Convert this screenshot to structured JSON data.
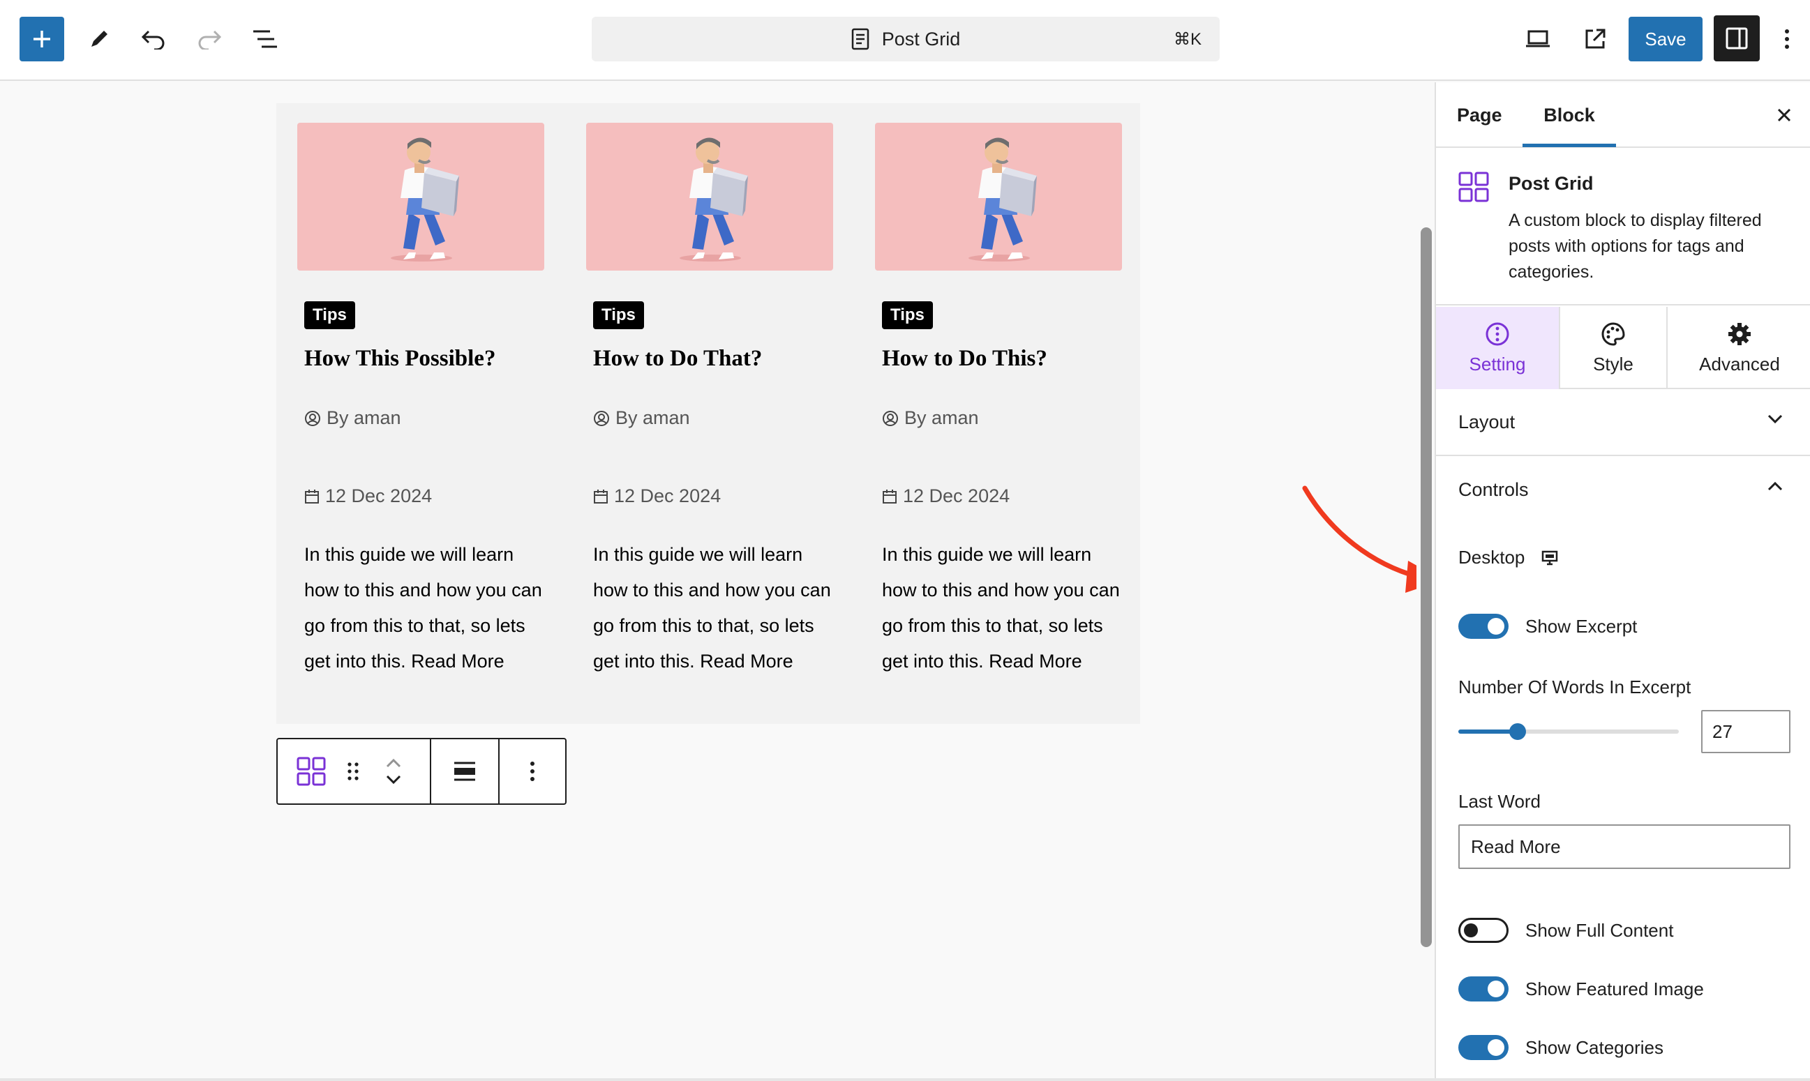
{
  "topbar": {
    "command_title": "Post Grid",
    "command_shortcut": "⌘K",
    "save_label": "Save"
  },
  "posts": [
    {
      "category": "Tips",
      "title": "How This Possible?",
      "author": "By aman",
      "date": "12 Dec 2024",
      "excerpt": "In this guide we will learn how to this and how you can go from this to that, so lets get into this. Read More"
    },
    {
      "category": "Tips",
      "title": "How to Do That?",
      "author": "By aman",
      "date": "12 Dec 2024",
      "excerpt": "In this guide we will learn how to this and how you can go from this to that, so lets get into this. Read More"
    },
    {
      "category": "Tips",
      "title": "How to Do This?",
      "author": "By aman",
      "date": "12 Dec 2024",
      "excerpt": "In this guide we will learn how to this and how you can go from this to that, so lets get into this. Read More"
    }
  ],
  "sidebar": {
    "tabs": {
      "page": "Page",
      "block": "Block"
    },
    "block": {
      "name": "Post Grid",
      "description": "A custom block to display filtered posts with options for tags and categories."
    },
    "sub_tabs": {
      "setting": "Setting",
      "style": "Style",
      "advanced": "Advanced"
    },
    "panels": {
      "layout": "Layout",
      "controls": "Controls"
    },
    "controls": {
      "device": "Desktop",
      "show_excerpt": {
        "label": "Show Excerpt",
        "on": true
      },
      "words_label": "Number Of Words In Excerpt",
      "words_value": "27",
      "words_fraction": 0.27,
      "last_word_label": "Last Word",
      "last_word_value": "Read More",
      "show_full_content": {
        "label": "Show Full Content",
        "on": false
      },
      "show_featured_image": {
        "label": "Show Featured Image",
        "on": true
      },
      "show_categories": {
        "label": "Show Categories",
        "on": true
      }
    }
  },
  "colors": {
    "accent": "#2271b1",
    "purple": "#7a32d6",
    "card_image_bg": "#f5bebe",
    "arrow": "#f03a1f"
  }
}
